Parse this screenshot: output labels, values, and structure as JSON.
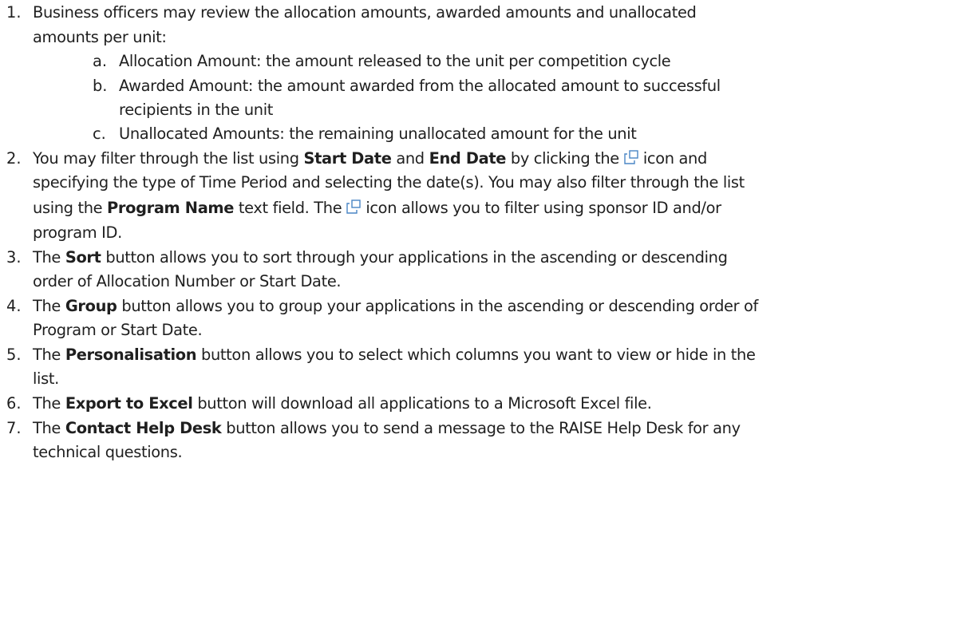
{
  "items": [
    {
      "num": "1.",
      "lines": [
        "Business officers may review the allocation amounts, awarded amounts and unallocated",
        "amounts per unit:"
      ],
      "sub": [
        {
          "letter": "a.",
          "lines": [
            "Allocation Amount: the amount released to the unit per competition cycle"
          ]
        },
        {
          "letter": "b.",
          "lines": [
            "Awarded Amount: the amount awarded from the allocated amount to successful",
            "recipients in the unit"
          ]
        },
        {
          "letter": "c.",
          "lines": [
            "Unallocated Amounts: the remaining unallocated amount for the unit"
          ]
        }
      ]
    },
    {
      "num": "2.",
      "t1": "You may filter through the list using ",
      "b1": "Start Date",
      "t2": " and ",
      "b2": "End Date",
      "t3": " by clicking the",
      "t4": "icon and",
      "l2": "specifying the type of Time Period and selecting the date(s). You may also filter through the list",
      "l3a": "using the ",
      "l3b": "Program Name",
      "l3c": " text field. The",
      "l3d": "icon allows you to filter using sponsor ID and/or",
      "l4": "program ID."
    },
    {
      "num": "3.",
      "a": "The ",
      "b": "Sort",
      "c": " button allows you to sort through your applications in the ascending or descending",
      "l2": "order of Allocation Number or Start Date."
    },
    {
      "num": "4.",
      "a": "The ",
      "b": "Group",
      "c": " button allows you to group your applications in the ascending or descending order of",
      "l2": "Program or Start Date."
    },
    {
      "num": "5.",
      "a": "The ",
      "b": "Personalisation",
      "c": " button allows you to select which columns you want to view or hide in the",
      "l2": "list."
    },
    {
      "num": "6.",
      "a": "The ",
      "b": "Export to Excel",
      "c": " button will download all applications to a Microsoft Excel file."
    },
    {
      "num": "7.",
      "a": "The ",
      "b": "Contact Help Desk",
      "c": " button allows you to send a message to the RAISE Help Desk for any",
      "l2": "technical questions."
    }
  ],
  "icon_name": "value-help-icon",
  "icon_color": "#4a86c5"
}
